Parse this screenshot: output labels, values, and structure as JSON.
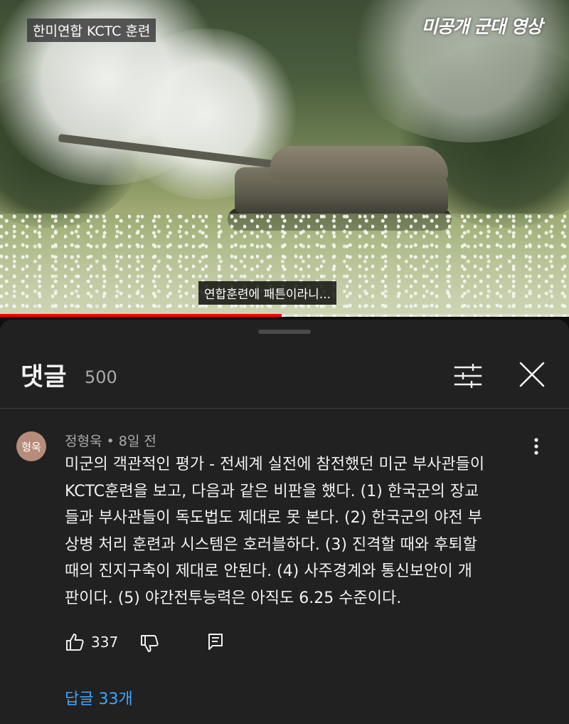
{
  "video": {
    "overlay_title": "한미연합 KCTC 훈련",
    "channel_watermark": "미공개 군대 영상",
    "subtitle": "연합훈련에 패튼이라니...",
    "progress": 0.495,
    "progress_color": "#ff0000"
  },
  "comments_panel": {
    "title": "댓글",
    "count": "500",
    "filter_icon": "sort-filter-icon",
    "close_icon": "close-icon"
  },
  "comment": {
    "avatar_text": "형욱",
    "author": "정형욱",
    "separator": "•",
    "time": "8일 전",
    "lines": [
      "미군의 객관적인 평가 - 전세계 실전에 참전했던 미군 부사관들이",
      "KCTC훈련을 보고, 다음과 같은 비판을 했다. (1) 한국군의 장교",
      "들과 부사관들이 독도법도 제대로 못 본다. (2) 한국군의 야전 부",
      "상병 처리 훈련과 시스템은 호러블하다. (3) 진격할 때와 후퇴할",
      "때의 진지구축이 제대로 안된다. (4) 사주경계와 통신보안이 개",
      "판이다. (5) 야간전투능력은 아직도 6.25 수준이다."
    ],
    "likes": "337",
    "replies_label": "답글 33개",
    "reply_link_color": "#3ea6ff"
  }
}
